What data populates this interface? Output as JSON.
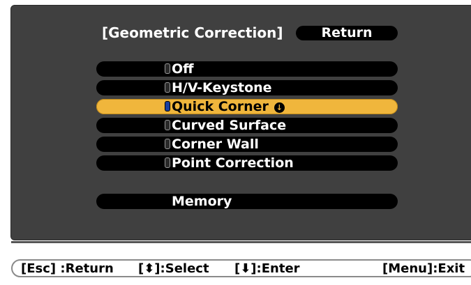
{
  "dialog": {
    "title": "[Geometric Correction]",
    "return_label": "Return",
    "options": [
      {
        "label": "Off",
        "selected": false
      },
      {
        "label": "H/V-Keystone",
        "selected": false
      },
      {
        "label": "Quick Corner",
        "selected": true
      },
      {
        "label": "Curved Surface",
        "selected": false
      },
      {
        "label": "Corner Wall",
        "selected": false
      },
      {
        "label": "Point Correction",
        "selected": false
      }
    ],
    "memory_label": "Memory",
    "highlight_color": "#f0b63c"
  },
  "footer": {
    "esc_hint": "[Esc] :Return",
    "select_hint": "[⬍]:Select",
    "enter_hint": "[⬇]:Enter",
    "menu_hint": "[Menu]:Exit"
  }
}
